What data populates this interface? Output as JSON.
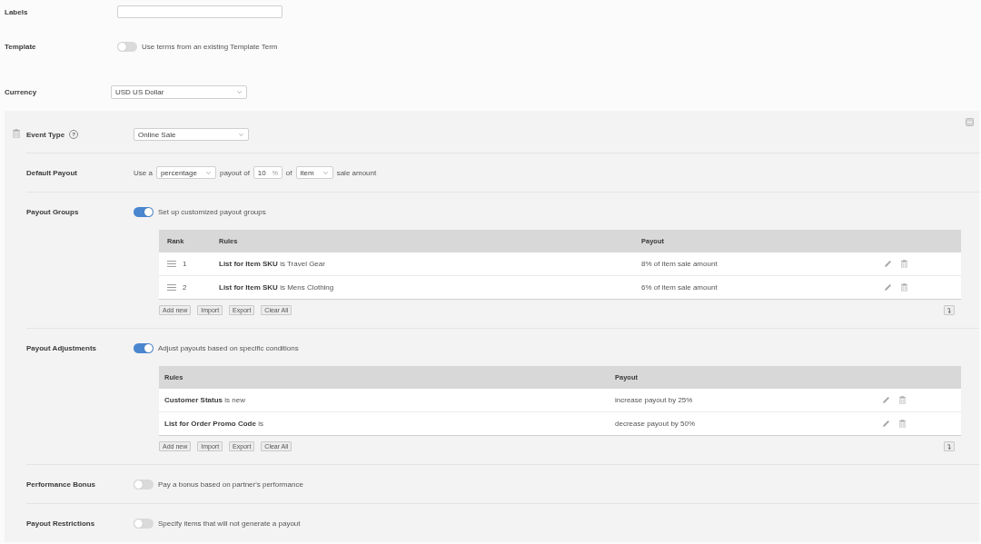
{
  "form": {
    "fields": [
      {
        "kind": "input",
        "label": "Labels"
      },
      {
        "kind": "toggle",
        "label": "Template",
        "on": false,
        "text": "Use terms from an existing Template Term"
      },
      {
        "kind": "select",
        "label": "Currency",
        "value": "USD US Dollar"
      }
    ]
  },
  "event": {
    "label": "Event Type",
    "help": "?",
    "value": "Online Sale",
    "sections": [
      {
        "kind": "sentence",
        "label": "Default Payout",
        "parts": [
          {
            "kind": "text",
            "text": "Use a"
          },
          {
            "kind": "select",
            "value": "percentage"
          },
          {
            "kind": "text",
            "text": "payout of"
          },
          {
            "kind": "number",
            "value": "10",
            "unit": "%"
          },
          {
            "kind": "text",
            "text": "of"
          },
          {
            "kind": "select",
            "value": "item"
          },
          {
            "kind": "text",
            "text": "sale amount"
          }
        ]
      },
      {
        "kind": "toggle",
        "label": "Payout Groups",
        "on": true,
        "text": "Set up customized payout groups",
        "table": {
          "columns": [
            "Rank",
            "Rules",
            "Payout"
          ],
          "rows": [
            {
              "rank": "1",
              "rule": "**List for Item SKU** is Travel Gear",
              "payout": "8% of item sale amount"
            },
            {
              "rank": "2",
              "rule": "**List for Item SKU** is Mens Clothing",
              "payout": "6% of item sale amount"
            }
          ],
          "buttons": [
            "Add new",
            "Import",
            "Export",
            "Clear All"
          ]
        }
      },
      {
        "kind": "toggle",
        "label": "Payout Adjustments",
        "on": true,
        "text": "Adjust payouts based on specific conditions",
        "table": {
          "columns": [
            "Rules",
            "Payout"
          ],
          "rows": [
            {
              "rule": "**Customer Status** is new",
              "payout": "increase payout by 25%"
            },
            {
              "rule": "**List for Order Promo Code** is",
              "payout": "decrease payout by 50%"
            }
          ],
          "buttons": [
            "Add new",
            "Import",
            "Export",
            "Clear All"
          ]
        }
      },
      {
        "kind": "toggle",
        "label": "Performance Bonus",
        "on": false,
        "text": "Pay a bonus based on partner's performance"
      },
      {
        "kind": "toggle",
        "label": "Payout Restrictions",
        "on": false,
        "text": "Specify items that will not generate a payout"
      }
    ]
  }
}
